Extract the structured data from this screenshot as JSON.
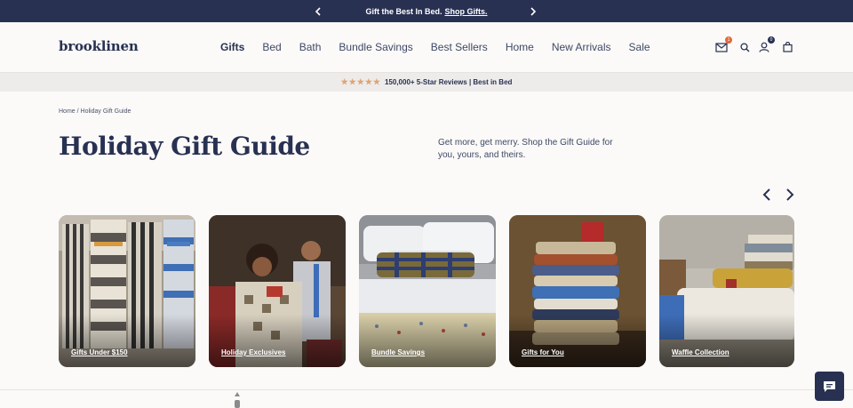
{
  "promo": {
    "text": "Gift the Best In Bed.",
    "link": "Shop Gifts.",
    "prev_icon": "chevron-left-icon",
    "next_icon": "chevron-right-icon"
  },
  "header": {
    "logo": "brooklinen",
    "nav": [
      "Gifts",
      "Bed",
      "Bath",
      "Bundle Savings",
      "Best Sellers",
      "Home",
      "New Arrivals",
      "Sale"
    ],
    "active_nav": "Gifts",
    "icons": [
      "mail-icon",
      "search-icon",
      "account-icon",
      "bag-icon"
    ],
    "mail_badge": "1",
    "account_badge": "0"
  },
  "reviews": {
    "rating_icon": "star-icon",
    "text": "150,000+ 5-Star Reviews | Best in Bed"
  },
  "breadcrumb": {
    "home": "Home",
    "separator": "/",
    "current": "Holiday Gift Guide"
  },
  "page": {
    "title": "Holiday Gift Guide",
    "intro": "Get more, get merry. Shop the Gift Guide for you, yours, and theirs."
  },
  "carousel": {
    "prev_icon": "chevron-left-icon",
    "next_icon": "chevron-right-icon",
    "cards": [
      {
        "label": "Gifts Under $150"
      },
      {
        "label": "Holiday Exclusives"
      },
      {
        "label": "Bundle Savings"
      },
      {
        "label": "Gifts for You"
      },
      {
        "label": "Waffle Collection"
      }
    ]
  },
  "chat": {
    "icon": "chat-icon"
  },
  "colors": {
    "navy": "#283152",
    "star": "#e0a373",
    "page_bg": "#fbfaf8",
    "strip_bg": "#eeecea",
    "badge": "#e06a3b"
  }
}
